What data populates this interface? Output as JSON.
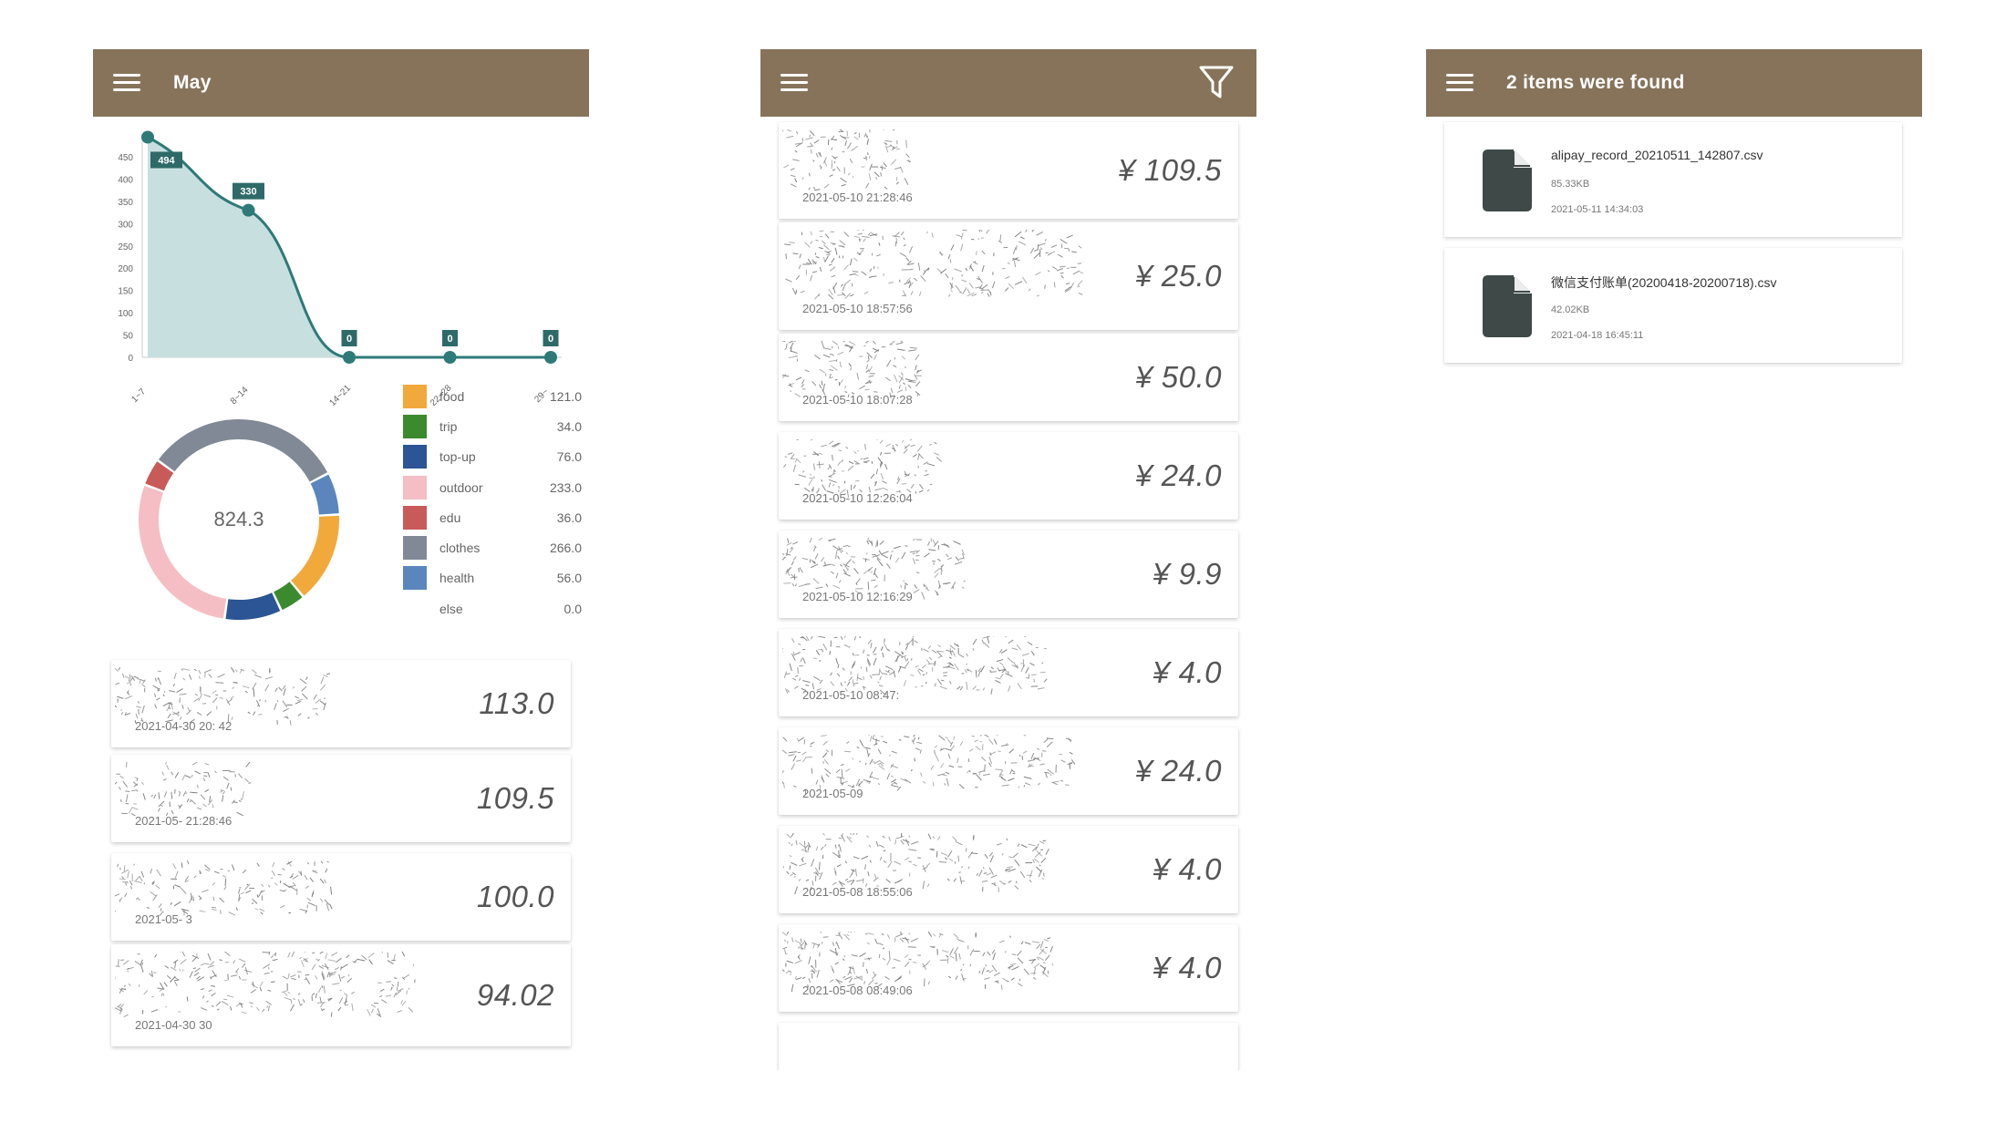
{
  "screen1": {
    "title": "May",
    "chart_data": {
      "type": "area",
      "categories": [
        "1~7",
        "8~14",
        "14~21",
        "22~28",
        "29~"
      ],
      "values": [
        494,
        330,
        0,
        0,
        0
      ],
      "ylim": [
        0,
        450
      ],
      "yticks": [
        "450",
        "400",
        "350",
        "300",
        "250",
        "200",
        "150",
        "100",
        "50",
        "0"
      ],
      "data_labels": [
        "494",
        "330",
        "0",
        "0",
        "0"
      ],
      "color": "#2e7a78",
      "fill": "#c7e0df"
    },
    "donut": {
      "total": "824.3",
      "type": "pie",
      "slices": [
        {
          "name": "food",
          "value": 121.0,
          "color": "#f2a93b"
        },
        {
          "name": "trip",
          "value": 34.0,
          "color": "#3c8a2e"
        },
        {
          "name": "top-up",
          "value": 76.0,
          "color": "#2b5594"
        },
        {
          "name": "outdoor",
          "value": 233.0,
          "color": "#f4bec4"
        },
        {
          "name": "edu",
          "value": 36.0,
          "color": "#c85a5a"
        },
        {
          "name": "clothes",
          "value": 266.0,
          "color": "#818996"
        },
        {
          "name": "health",
          "value": 56.0,
          "color": "#5a86bd"
        },
        {
          "name": "else",
          "value": 0.0,
          "color": "#ffffff"
        }
      ]
    },
    "legend": [
      {
        "label": "food",
        "value": "121.0",
        "color": "#f2a93b"
      },
      {
        "label": "trip",
        "value": "34.0",
        "color": "#3c8a2e"
      },
      {
        "label": "top-up",
        "value": "76.0",
        "color": "#2b5594"
      },
      {
        "label": "outdoor",
        "value": "233.0",
        "color": "#f4bec4"
      },
      {
        "label": "edu",
        "value": "36.0",
        "color": "#c85a5a"
      },
      {
        "label": "clothes",
        "value": "266.0",
        "color": "#818996"
      },
      {
        "label": "health",
        "value": "56.0",
        "color": "#5a86bd"
      },
      {
        "label": "else",
        "value": "0.0",
        "color": "#ffffff"
      }
    ],
    "records": [
      {
        "amount": "113.0",
        "time": "2021-04-30 20:  42"
      },
      {
        "amount": "109.5",
        "time": "2021-05-  21:28:46"
      },
      {
        "amount": "100.0",
        "time": "2021-05-  3"
      },
      {
        "amount": "94.02",
        "time": "2021-04-30  30"
      }
    ]
  },
  "screen2": {
    "records": [
      {
        "amount": "¥ 109.5",
        "time": "2021-05-10 21:28:46"
      },
      {
        "amount": "¥ 25.0",
        "time": "2021-05-10 18:57:56"
      },
      {
        "amount": "¥ 50.0",
        "time": "2021-05-10 18:07:28"
      },
      {
        "amount": "¥ 24.0",
        "time": "2021-05-10 12:26:04"
      },
      {
        "amount": "¥ 9.9",
        "time": "2021-05-10 12:16:29"
      },
      {
        "amount": "¥ 4.0",
        "time": "2021-05-10 08:47:"
      },
      {
        "amount": "¥ 24.0",
        "time": "2021-05-09 "
      },
      {
        "amount": "¥ 4.0",
        "time": "2021-05-08 18:55:06"
      },
      {
        "amount": "¥ 4.0",
        "time": "2021-05-08 08:49:06"
      }
    ]
  },
  "screen3": {
    "title": "2 items were found",
    "files": [
      {
        "name": "alipay_record_20210511_142807.csv",
        "size": "85.33KB",
        "time": "2021-05-11 14:34:03"
      },
      {
        "name": "微信支付账单(20200418-20200718).csv",
        "size": "42.02KB",
        "time": "2021-04-18 16:45:11"
      }
    ]
  }
}
